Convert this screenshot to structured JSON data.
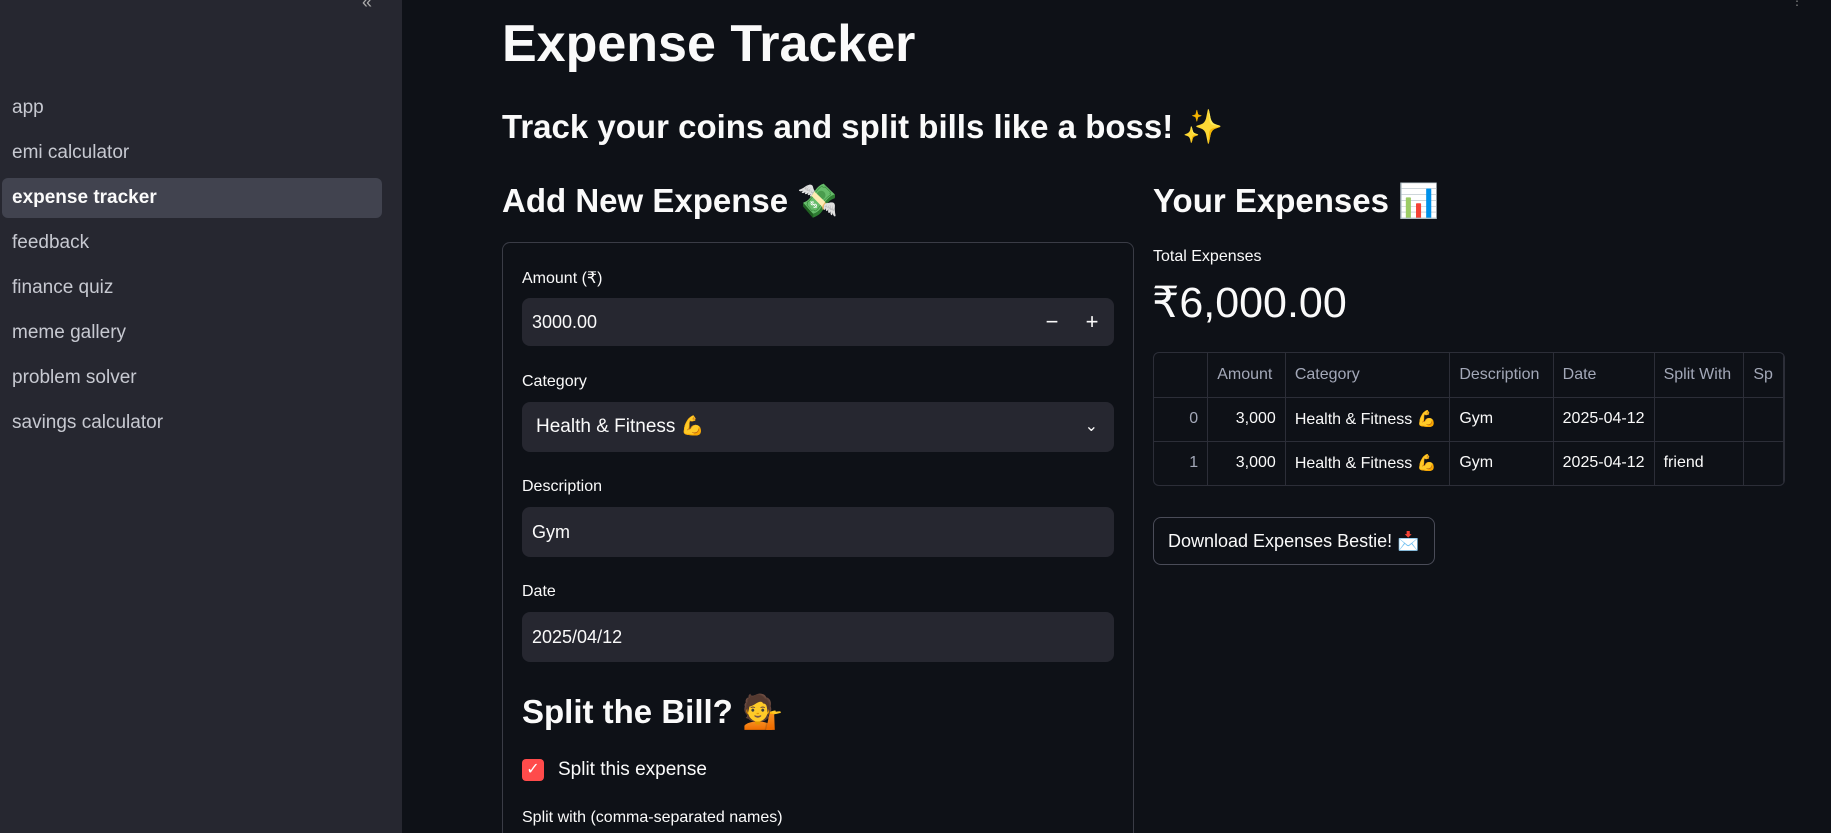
{
  "sidebar": {
    "close_glyph": "«",
    "items": [
      {
        "label": "app",
        "active": false
      },
      {
        "label": "emi calculator",
        "active": false
      },
      {
        "label": "expense tracker",
        "active": true
      },
      {
        "label": "feedback",
        "active": false
      },
      {
        "label": "finance quiz",
        "active": false
      },
      {
        "label": "meme gallery",
        "active": false
      },
      {
        "label": "problem solver",
        "active": false
      },
      {
        "label": "savings calculator",
        "active": false
      }
    ]
  },
  "page": {
    "title": "Expense Tracker",
    "subtitle": "Track your coins and split bills like a boss! ✨"
  },
  "form": {
    "heading": "Add New Expense 💸",
    "amount_label": "Amount (₹)",
    "amount_value": "3000.00",
    "minus": "−",
    "plus": "+",
    "category_label": "Category",
    "category_value": "Health & Fitness 💪",
    "description_label": "Description",
    "description_value": "Gym",
    "date_label": "Date",
    "date_value": "2025/04/12",
    "split_heading": "Split the Bill? 💁",
    "split_checkbox_label": "Split this expense",
    "split_checked": true,
    "split_with_label": "Split with (comma-separated names)"
  },
  "expenses": {
    "heading": "Your Expenses 📊",
    "total_label": "Total Expenses",
    "total_value": "₹6,000.00",
    "columns": [
      "",
      "Amount",
      "Category",
      "Description",
      "Date",
      "Split With",
      "Sp"
    ],
    "rows": [
      [
        "0",
        "3,000",
        "Health & Fitness 💪",
        "Gym",
        "2025-04-12",
        "",
        ""
      ],
      [
        "1",
        "3,000",
        "Health & Fitness 💪",
        "Gym",
        "2025-04-12",
        "friend",
        ""
      ]
    ],
    "download_label": "Download Expenses Bestie! 📩"
  },
  "colors": {
    "background": "#0e1117",
    "sidebar": "#262730",
    "accent": "#ff4b4b"
  }
}
